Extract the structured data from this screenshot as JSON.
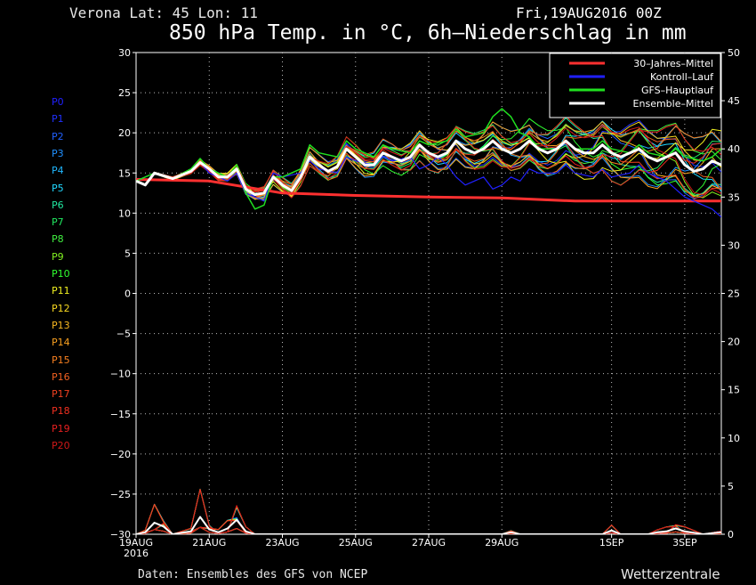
{
  "header": {
    "location": "Verona   Lat: 45 Lon: 11",
    "date": "Fri,19AUG2016 00Z",
    "title": "850 hPa Temp. in °C, 6h–Niederschlag in mm"
  },
  "footer": {
    "source": "Daten: Ensembles des GFS von NCEP",
    "brand": "Wetterzentrale"
  },
  "members": [
    {
      "label": "P0",
      "color": "#2020ff"
    },
    {
      "label": "P1",
      "color": "#2030ff"
    },
    {
      "label": "P2",
      "color": "#2060ff"
    },
    {
      "label": "P3",
      "color": "#2090ff"
    },
    {
      "label": "P4",
      "color": "#20b8ff"
    },
    {
      "label": "P5",
      "color": "#20d8ff"
    },
    {
      "label": "P6",
      "color": "#20e8a0"
    },
    {
      "label": "P7",
      "color": "#20e860"
    },
    {
      "label": "P8",
      "color": "#40f040"
    },
    {
      "label": "P9",
      "color": "#80f020"
    },
    {
      "label": "P10",
      "color": "#30ff30"
    },
    {
      "label": "P11",
      "color": "#f0f020"
    },
    {
      "label": "P12",
      "color": "#f8d820"
    },
    {
      "label": "P13",
      "color": "#f8b820"
    },
    {
      "label": "P14",
      "color": "#f8a020"
    },
    {
      "label": "P15",
      "color": "#f88020"
    },
    {
      "label": "P16",
      "color": "#f06020"
    },
    {
      "label": "P17",
      "color": "#f04020"
    },
    {
      "label": "P18",
      "color": "#f03020"
    },
    {
      "label": "P19",
      "color": "#e82020"
    },
    {
      "label": "P20",
      "color": "#d01818"
    }
  ],
  "chart_data": {
    "type": "line",
    "x_labels": [
      {
        "label": "19AUG",
        "sub": "2016",
        "day": 0
      },
      {
        "label": "21AUG",
        "day": 2
      },
      {
        "label": "23AUG",
        "day": 4
      },
      {
        "label": "25AUG",
        "day": 6
      },
      {
        "label": "27AUG",
        "day": 8
      },
      {
        "label": "29AUG",
        "day": 10
      },
      {
        "label": "1SEP",
        "day": 13
      },
      {
        "label": "3SEP",
        "day": 15
      }
    ],
    "x_range_days": [
      0,
      16
    ],
    "y_left": {
      "range": [
        -30,
        30
      ],
      "ticks": [
        30,
        25,
        20,
        15,
        10,
        5,
        0,
        -5,
        -10,
        -15,
        -20,
        -25,
        -30
      ]
    },
    "y_right": {
      "range": [
        0,
        50
      ],
      "ticks": [
        50,
        45,
        40,
        35,
        30,
        25,
        20,
        15,
        10,
        5,
        0
      ]
    },
    "grid": true,
    "legend_position": "top-right",
    "legend": [
      {
        "name": "30–Jahres–Mittel",
        "color": "#ff3030"
      },
      {
        "name": "Kontroll–Lauf",
        "color": "#2020ff"
      },
      {
        "name": "GFS–Hauptlauf",
        "color": "#20e020"
      },
      {
        "name": "Ensemble–Mittel",
        "color": "#ffffff"
      }
    ],
    "climate_mean": [
      [
        0,
        14.2
      ],
      [
        2,
        14.0
      ],
      [
        4,
        12.5
      ],
      [
        6,
        12.2
      ],
      [
        8,
        12.0
      ],
      [
        10,
        11.9
      ],
      [
        12,
        11.5
      ],
      [
        16,
        11.5
      ]
    ],
    "ensemble_mean": [
      [
        0,
        14
      ],
      [
        0.25,
        13.5
      ],
      [
        0.5,
        15
      ],
      [
        1,
        14.3
      ],
      [
        1.5,
        15.2
      ],
      [
        1.75,
        16.3
      ],
      [
        2,
        15.5
      ],
      [
        2.25,
        14.5
      ],
      [
        2.5,
        14.5
      ],
      [
        2.75,
        15.5
      ],
      [
        3,
        13
      ],
      [
        3.25,
        12.3
      ],
      [
        3.5,
        12.5
      ],
      [
        3.75,
        14.5
      ],
      [
        4,
        13.5
      ],
      [
        4.25,
        12.8
      ],
      [
        4.5,
        14.5
      ],
      [
        4.75,
        17
      ],
      [
        5,
        16
      ],
      [
        5.25,
        15.2
      ],
      [
        5.5,
        15.8
      ],
      [
        5.75,
        18
      ],
      [
        6,
        17
      ],
      [
        6.25,
        16
      ],
      [
        6.5,
        16
      ],
      [
        6.75,
        17.5
      ],
      [
        7,
        17
      ],
      [
        7.25,
        16.5
      ],
      [
        7.5,
        17
      ],
      [
        7.75,
        18.5
      ],
      [
        8,
        17.5
      ],
      [
        8.25,
        17
      ],
      [
        8.5,
        17.5
      ],
      [
        8.75,
        19
      ],
      [
        9,
        18
      ],
      [
        9.25,
        17.5
      ],
      [
        9.5,
        18
      ],
      [
        9.75,
        19
      ],
      [
        10,
        18
      ],
      [
        10.25,
        17.5
      ],
      [
        10.5,
        18
      ],
      [
        10.75,
        19
      ],
      [
        11,
        18
      ],
      [
        11.25,
        17.5
      ],
      [
        11.5,
        18
      ],
      [
        11.75,
        19
      ],
      [
        12,
        18
      ],
      [
        12.25,
        17.5
      ],
      [
        12.5,
        17.5
      ],
      [
        12.75,
        18.5
      ],
      [
        13,
        17.5
      ],
      [
        13.25,
        17
      ],
      [
        13.5,
        17.5
      ],
      [
        13.75,
        18
      ],
      [
        14,
        17
      ],
      [
        14.25,
        16.5
      ],
      [
        14.5,
        17
      ],
      [
        14.75,
        17.5
      ],
      [
        15,
        16
      ],
      [
        15.25,
        15.2
      ],
      [
        15.5,
        15.5
      ],
      [
        15.75,
        16.5
      ],
      [
        16,
        16
      ]
    ],
    "gfs_main": [
      [
        0,
        14
      ],
      [
        0.5,
        15
      ],
      [
        1,
        14.3
      ],
      [
        1.5,
        15.5
      ],
      [
        1.75,
        16.8
      ],
      [
        2,
        15.5
      ],
      [
        2.5,
        14.5
      ],
      [
        2.75,
        16
      ],
      [
        3,
        12.5
      ],
      [
        3.25,
        10.5
      ],
      [
        3.5,
        11
      ],
      [
        3.75,
        14.5
      ],
      [
        4,
        14.5
      ],
      [
        4.5,
        15.5
      ],
      [
        4.75,
        18.5
      ],
      [
        5,
        17.5
      ],
      [
        5.5,
        17
      ],
      [
        5.75,
        19
      ],
      [
        6,
        18
      ],
      [
        6.5,
        17
      ],
      [
        6.75,
        18.5
      ],
      [
        7,
        18
      ],
      [
        7.5,
        17.5
      ],
      [
        7.75,
        19
      ],
      [
        8,
        18.5
      ],
      [
        8.5,
        19
      ],
      [
        8.75,
        20.5
      ],
      [
        9,
        19.5
      ],
      [
        9.5,
        20
      ],
      [
        9.75,
        22
      ],
      [
        10,
        23
      ],
      [
        10.25,
        22
      ],
      [
        10.5,
        20
      ],
      [
        10.75,
        19.5
      ],
      [
        11,
        18
      ],
      [
        11.5,
        18
      ],
      [
        11.75,
        19
      ],
      [
        12,
        18
      ],
      [
        12.5,
        18
      ],
      [
        12.75,
        19
      ],
      [
        13,
        18
      ],
      [
        13.5,
        17.5
      ],
      [
        13.75,
        18.5
      ],
      [
        14,
        17.5
      ],
      [
        14.5,
        17
      ],
      [
        14.75,
        18
      ],
      [
        15,
        17
      ],
      [
        15.5,
        16.5
      ],
      [
        15.75,
        17
      ],
      [
        16,
        18
      ]
    ],
    "control_run": [
      [
        0,
        14
      ],
      [
        0.5,
        15
      ],
      [
        1,
        14.3
      ],
      [
        1.5,
        15.5
      ],
      [
        1.75,
        16.3
      ],
      [
        2,
        15
      ],
      [
        2.5,
        14
      ],
      [
        2.75,
        15
      ],
      [
        3,
        12.5
      ],
      [
        3.5,
        11.5
      ],
      [
        3.75,
        15
      ],
      [
        4,
        14.5
      ],
      [
        4.5,
        15
      ],
      [
        4.75,
        16.5
      ],
      [
        5,
        15.5
      ],
      [
        5.5,
        15
      ],
      [
        5.75,
        17
      ],
      [
        6,
        16.5
      ],
      [
        6.5,
        16
      ],
      [
        6.75,
        17
      ],
      [
        7,
        16.5
      ],
      [
        7.5,
        17
      ],
      [
        7.75,
        15.5
      ],
      [
        8,
        16
      ],
      [
        8.25,
        17
      ],
      [
        8.5,
        16
      ],
      [
        8.75,
        14.5
      ],
      [
        9,
        13.5
      ],
      [
        9.25,
        14
      ],
      [
        9.5,
        14.5
      ],
      [
        9.75,
        13
      ],
      [
        10,
        13.5
      ],
      [
        10.25,
        14.5
      ],
      [
        10.5,
        14
      ],
      [
        10.75,
        15.5
      ],
      [
        11,
        15
      ],
      [
        11.5,
        15
      ],
      [
        11.75,
        16
      ],
      [
        12,
        15
      ],
      [
        12.5,
        14.5
      ],
      [
        12.75,
        15.5
      ],
      [
        13,
        14.5
      ],
      [
        13.5,
        15
      ],
      [
        13.75,
        16
      ],
      [
        14,
        15
      ],
      [
        14.5,
        14
      ],
      [
        14.75,
        13
      ],
      [
        15,
        12
      ],
      [
        15.5,
        11
      ],
      [
        15.75,
        10.5
      ],
      [
        16,
        9.5
      ]
    ],
    "precip_ensemble_mean": [
      [
        0,
        0
      ],
      [
        0.25,
        0.2
      ],
      [
        0.5,
        1.2
      ],
      [
        0.75,
        0.8
      ],
      [
        1,
        0
      ],
      [
        1.5,
        0.3
      ],
      [
        1.75,
        1.8
      ],
      [
        2,
        0.5
      ],
      [
        2.25,
        0.2
      ],
      [
        2.5,
        0.6
      ],
      [
        2.75,
        1.5
      ],
      [
        3,
        0.3
      ],
      [
        3.25,
        0
      ],
      [
        3.5,
        0
      ],
      [
        4,
        0
      ],
      [
        10,
        0
      ],
      [
        10.25,
        0.2
      ],
      [
        10.5,
        0
      ],
      [
        12.75,
        0
      ],
      [
        13,
        0.4
      ],
      [
        13.25,
        0
      ],
      [
        14,
        0
      ],
      [
        14.25,
        0.2
      ],
      [
        14.5,
        0.3
      ],
      [
        14.75,
        0.6
      ],
      [
        15,
        0.3
      ],
      [
        15.5,
        0
      ],
      [
        16,
        0.2
      ]
    ]
  }
}
